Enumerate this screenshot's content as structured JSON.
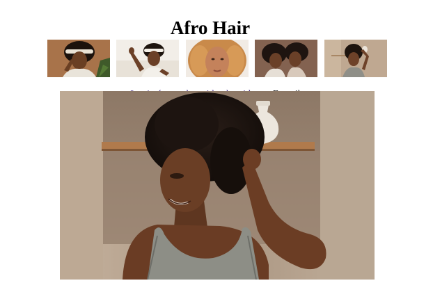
{
  "page": {
    "title": "Afro Hair"
  },
  "gallery": {
    "thumbnails": [
      {
        "subject": "woman-with-headband"
      },
      {
        "subject": "woman-raising-arm-headband"
      },
      {
        "subject": "woman-curly-blonde-hair"
      },
      {
        "subject": "two-women-afro-hair"
      },
      {
        "subject": "woman-hand-in-hair"
      }
    ]
  },
  "credit": {
    "link_text": "Las imágenes han sido obtenidas",
    "suffix": " en Freepik",
    "link_color": "#3b1f85"
  },
  "main_image": {
    "subject": "smiling-woman-with-afro-hair"
  }
}
